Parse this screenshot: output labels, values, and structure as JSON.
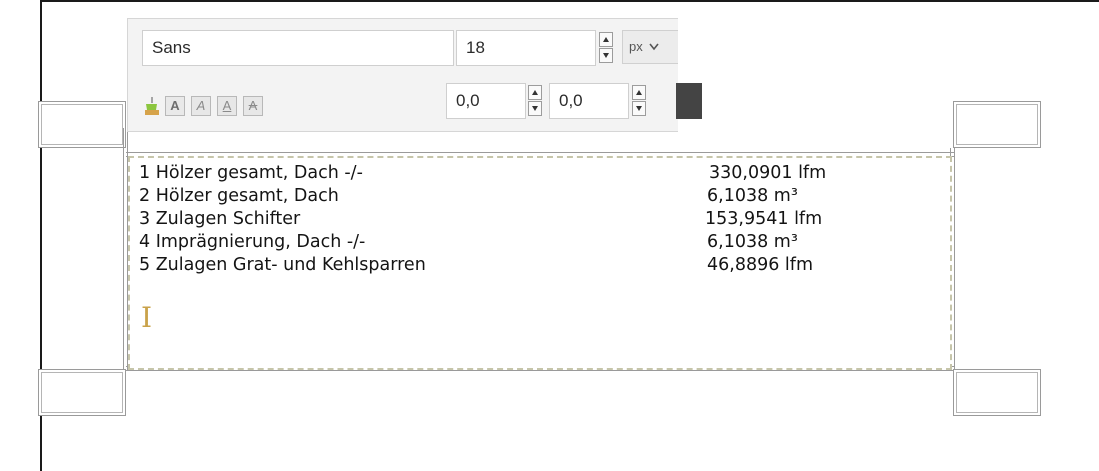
{
  "toolbar": {
    "font_family": "Sans",
    "font_size": "18",
    "unit": "px",
    "offset_x": "0,0",
    "offset_y": "0,0",
    "color_swatch": "#444444",
    "format_buttons": [
      "A",
      "A",
      "A",
      "A"
    ]
  },
  "text_box": {
    "lines": [
      {
        "label": "1 Hölzer gesamt, Dach  -/-",
        "value": "330,0901 lfm"
      },
      {
        "label": "2 Hölzer gesamt, Dach",
        "value": "6,1038 m³"
      },
      {
        "label": "3 Zulagen Schifter",
        "value": "153,9541 lfm"
      },
      {
        "label": "4 Imprägnierung, Dach  -/-",
        "value": "6,1038 m³"
      },
      {
        "label": "5 Zulagen Grat- und Kehlsparren",
        "value": "46,8896 lfm"
      }
    ]
  }
}
